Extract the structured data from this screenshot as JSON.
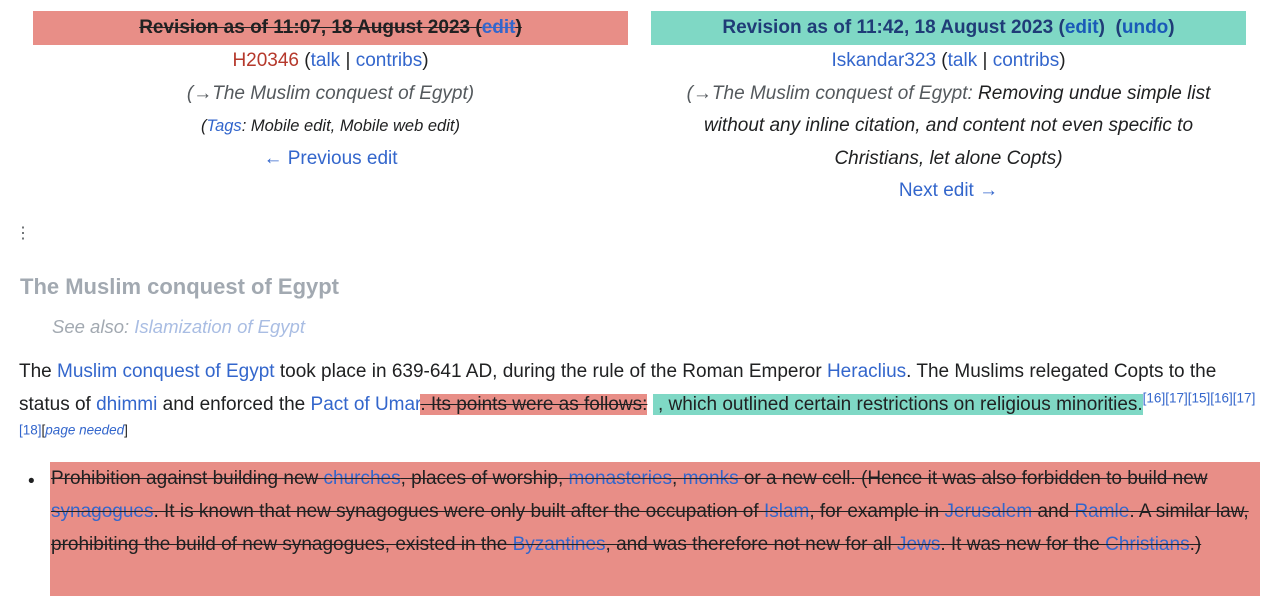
{
  "old_revision": {
    "header": "Revision as of 11:07, 18 August 2023",
    "edit_label": "edit",
    "user": "H20346",
    "talk": "talk",
    "contribs": "contribs",
    "summary": "(→The Muslim conquest of Egypt)",
    "tags_label": "Tags",
    "tags_value": ": Mobile edit, Mobile web edit)",
    "tags_open": "(",
    "nav": "← Previous edit"
  },
  "new_revision": {
    "header": "Revision as of 11:42, 18 August 2023",
    "edit_label": "edit",
    "undo_label": "undo",
    "user": "Iskandar323",
    "talk": "talk",
    "contribs": "contribs",
    "summary_arrow": "(→The Muslim conquest of Egypt:",
    "summary_text": " Removing undue simple list without any inline citation, and content not even specific to Christians, let alone Copts)",
    "nav": "Next edit →"
  },
  "vdots": "⋮",
  "section": {
    "title": "The Muslim conquest of Egypt",
    "see_also_label": "See also: ",
    "see_also_link": "Islamization of Egypt"
  },
  "paragraph": {
    "t1": "The ",
    "l1": "Muslim conquest of Egypt",
    "t2": " took place in 639-641 AD, during the rule of the Roman Emperor ",
    "l2": "Heraclius",
    "t3": ". The Muslims relegated Copts to the status of ",
    "l3": "dhimmi",
    "t4": " and enforced the ",
    "l4": "Pact of Umar",
    "deleted": ". Its points were as follows:",
    "inserted": " , which outlined certain restrictions on religious minorities.",
    "refs": [
      "[16]",
      "[17]",
      "[15]",
      "[16]",
      "[17]",
      "[18]"
    ],
    "page_needed": "page needed"
  },
  "bullet": {
    "b1": "Prohibition against building new ",
    "bl1": "churches",
    "b2": ", places of worship, ",
    "bl2": "monasteries",
    "b3": ", ",
    "bl3": "monks",
    "b4": " or a new cell. (Hence it was also forbidden to build new ",
    "bl4": "synagogues",
    "b5": ". It is known that new synagogues were only built after the occupation of ",
    "bl5": "Islam",
    "b6": ", for example in ",
    "bl6": "Jerusalem",
    "b7": " and ",
    "bl7": "Ramle",
    "b8": ". A similar law, prohibiting the build of new synagogues, existed in the ",
    "bl8": "Byzantines",
    "b9": ", and was therefore not new for all ",
    "bl9": "Jews",
    "b10": ". It was new for the ",
    "bl10": "Christians",
    "b11": ".)"
  },
  "colors": {
    "deleted_bg": "#e88e87",
    "inserted_bg": "#7fd8c5",
    "link": "#3366cc"
  }
}
